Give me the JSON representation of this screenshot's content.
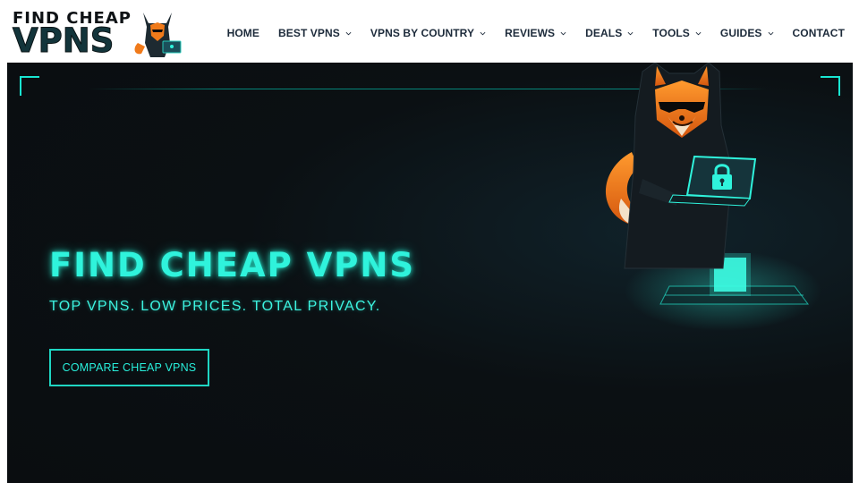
{
  "logo": {
    "line1": "FIND CHEAP",
    "line2": "VPNS",
    "mascot_icon": "hooded-fox-laptop-icon"
  },
  "nav": {
    "items": [
      {
        "label": "HOME",
        "has_dropdown": false
      },
      {
        "label": "BEST VPNS",
        "has_dropdown": true
      },
      {
        "label": "VPNS BY COUNTRY",
        "has_dropdown": true
      },
      {
        "label": "REVIEWS",
        "has_dropdown": true
      },
      {
        "label": "DEALS",
        "has_dropdown": true
      },
      {
        "label": "TOOLS",
        "has_dropdown": true
      },
      {
        "label": "GUIDES",
        "has_dropdown": true
      },
      {
        "label": "CONTACT",
        "has_dropdown": false
      }
    ],
    "chevron_icon": "chevron-down-icon"
  },
  "hero": {
    "title": "FIND CHEAP VPNS",
    "subtitle": "TOP VPNS. LOW PRICES. TOTAL PRIVACY.",
    "cta_label": "COMPARE CHEAP VPNS",
    "illustration_icon": "hooded-fox-hacker-icon",
    "lock_icon": "padlock-icon"
  },
  "colors": {
    "accent": "#2ff3dc",
    "hero_background": "#0a0d10",
    "nav_text": "#1c2a3a",
    "fox_orange": "#f07a1a"
  }
}
